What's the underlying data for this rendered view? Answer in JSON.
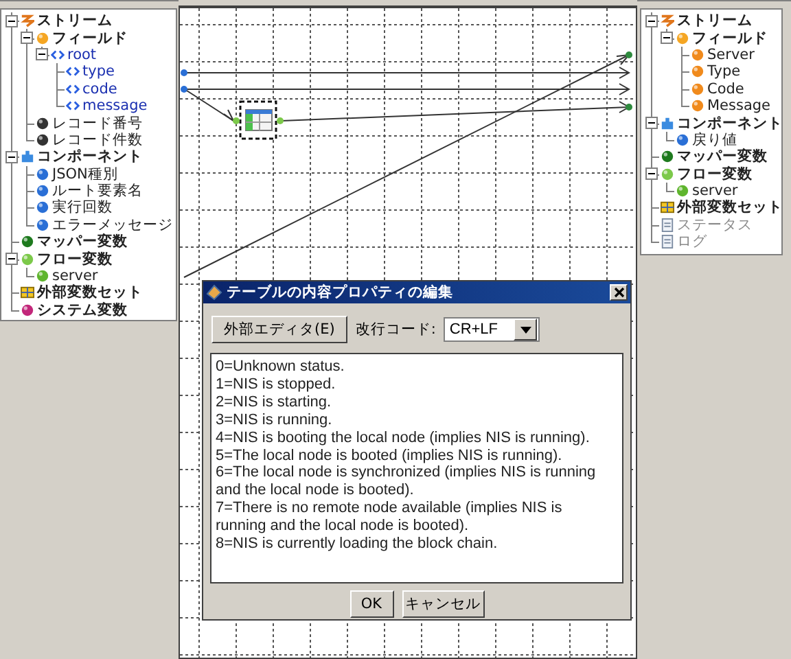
{
  "left_tree": [
    {
      "label": "ストリーム",
      "kind": "stream",
      "expanded": true,
      "children": [
        {
          "label": "フィールド",
          "kind": "field",
          "expanded": true,
          "children": [
            {
              "label": "root",
              "kind": "element",
              "expanded": true,
              "children": [
                {
                  "label": "type",
                  "kind": "element"
                },
                {
                  "label": "code",
                  "kind": "element"
                },
                {
                  "label": "message",
                  "kind": "element"
                }
              ]
            }
          ]
        },
        {
          "label": "レコード番号",
          "kind": "record"
        },
        {
          "label": "レコード件数",
          "kind": "record"
        }
      ]
    },
    {
      "label": "コンポーネント",
      "kind": "component",
      "expanded": true,
      "children": [
        {
          "label": "JSON種別",
          "kind": "component-item"
        },
        {
          "label": "ルート要素名",
          "kind": "component-item"
        },
        {
          "label": "実行回数",
          "kind": "component-item"
        },
        {
          "label": "エラーメッセージ",
          "kind": "component-item"
        }
      ]
    },
    {
      "label": "マッパー変数",
      "kind": "mapper"
    },
    {
      "label": "フロー変数",
      "kind": "flow",
      "expanded": true,
      "children": [
        {
          "label": "server",
          "kind": "flow-item"
        }
      ]
    },
    {
      "label": "外部変数セット",
      "kind": "external"
    },
    {
      "label": "システム変数",
      "kind": "system"
    }
  ],
  "right_tree": [
    {
      "label": "ストリーム",
      "kind": "stream",
      "disabled": false,
      "expanded": true,
      "children": [
        {
          "label": "フィールド",
          "kind": "field",
          "disabled": false,
          "expanded": true,
          "children": [
            {
              "label": "Server",
              "kind": "field-item",
              "disabled": false
            },
            {
              "label": "Type",
              "kind": "field-item",
              "disabled": false
            },
            {
              "label": "Code",
              "kind": "field-item",
              "disabled": false
            },
            {
              "label": "Message",
              "kind": "field-item",
              "disabled": false
            }
          ]
        }
      ]
    },
    {
      "label": "コンポーネント",
      "kind": "component",
      "disabled": false,
      "expanded": true,
      "children": [
        {
          "label": "戻り値",
          "kind": "component-item",
          "disabled": false
        }
      ]
    },
    {
      "label": "マッパー変数",
      "kind": "mapper",
      "disabled": false
    },
    {
      "label": "フロー変数",
      "kind": "flow",
      "disabled": false,
      "expanded": true,
      "children": [
        {
          "label": "server",
          "kind": "flow-item",
          "disabled": false
        }
      ]
    },
    {
      "label": "外部変数セット",
      "kind": "external",
      "disabled": false
    },
    {
      "label": "ステータス",
      "kind": "doc",
      "disabled": true
    },
    {
      "label": "ログ",
      "kind": "doc",
      "disabled": true
    }
  ],
  "dialog": {
    "title": "テーブルの内容プロパティの編集",
    "editor_button": "外部エディタ(E)",
    "newline_label": "改行コード:",
    "newline_select": {
      "value": "CR+LF"
    },
    "text_lines": [
      "0=Unknown status.",
      "1=NIS is stopped.",
      "2=NIS is starting.",
      "3=NIS is running.",
      "4=NIS is booting the local node (implies NIS is running).",
      "5=The local node is booted (implies NIS is running).",
      "6=The local node is synchronized (implies NIS is running and the local node is booted).",
      "7=There is no remote node available (implies NIS is running and the local node is booted).",
      "8=NIS is currently loading the block chain."
    ],
    "buttons": [
      "OK",
      "キャンセル"
    ]
  }
}
